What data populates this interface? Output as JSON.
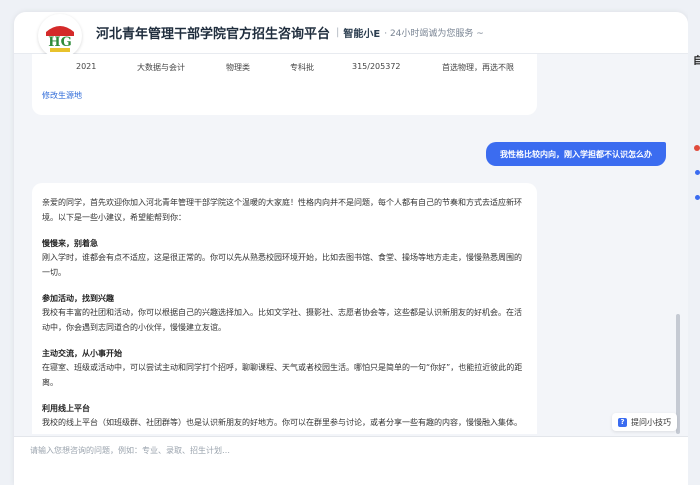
{
  "header": {
    "title": "河北青年管理干部学院官方招生咨询平台",
    "separator": "|",
    "assistant_name": "智能小E",
    "slogan": "· 24小时竭诚为您服务 ~",
    "logo_text": "HG"
  },
  "table": {
    "year": "2021",
    "major": "大数据与会计",
    "subject": "物理类",
    "batch": "专科批",
    "rank": "315/205372",
    "requirement": "首选物理，再选不限"
  },
  "modify_link": "修改生源地",
  "user_message": "我性格比较内向，刚入学担都不认识怎么办",
  "answer": {
    "intro": "亲爱的同学，首先欢迎你加入河北青年管理干部学院这个温暖的大家庭！性格内向并不是问题，每个人都有自己的节奏和方式去适应新环境。以下是一些小建议，希望能帮到你：",
    "sections": [
      {
        "title": "慢慢来，别着急",
        "body": "刚入学时，谁都会有点不适应，这是很正常的。你可以先从熟悉校园环境开始，比如去图书馆、食堂、操场等地方走走，慢慢熟悉周围的一切。"
      },
      {
        "title": "参加活动，找到兴趣",
        "body": "我校有丰富的社团和活动，你可以根据自己的兴趣选择加入。比如文学社、摄影社、志愿者协会等，这些都是认识新朋友的好机会。在活动中，你会遇到志同道合的小伙伴，慢慢建立友谊。"
      },
      {
        "title": "主动交流，从小事开始",
        "body": "在寝室、班级或活动中，可以尝试主动和同学打个招呼，聊聊课程、天气或者校园生活。哪怕只是简单的一句“你好”，也能拉近彼此的距离。"
      },
      {
        "title": "利用线上平台",
        "body": "我校的线上平台（如班级群、社团群等）也是认识新朋友的好地方。你可以在群里参与讨论，或者分享一些有趣的内容，慢慢融入集体。"
      }
    ]
  },
  "tips_button": "提问小技巧",
  "input": {
    "placeholder": "请输入您想咨询的问题，例如：专业、录取、招生计划…"
  },
  "right_panel": {
    "char": "自"
  },
  "colors": {
    "accent": "#3b6cf0",
    "link": "#2f6bd9",
    "background": "#f3f5f9"
  }
}
